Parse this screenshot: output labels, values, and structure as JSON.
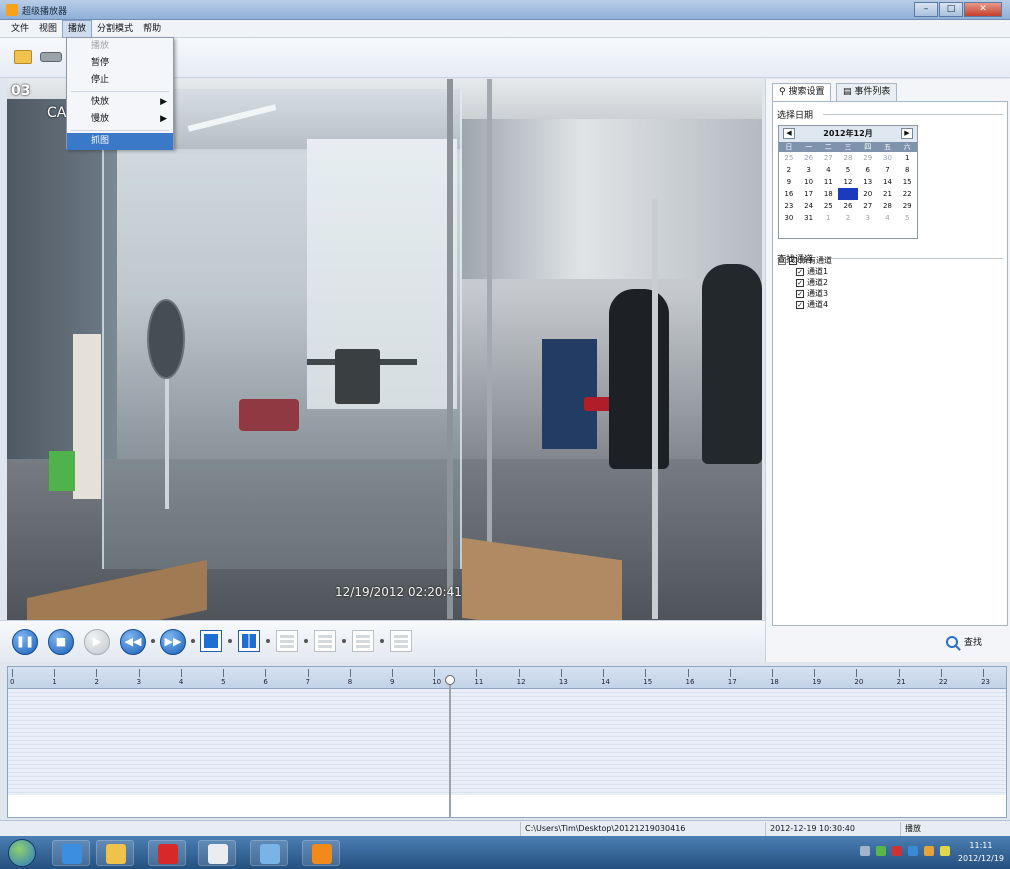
{
  "window": {
    "title": "超级播放器"
  },
  "menubar": {
    "items": [
      "文件",
      "视图",
      "播放",
      "分割模式",
      "帮助"
    ]
  },
  "play_menu": {
    "items": [
      {
        "label": "播放",
        "disabled": true
      },
      {
        "label": "暂停"
      },
      {
        "label": "停止"
      },
      {
        "label": "快放",
        "submenu": true
      },
      {
        "label": "慢放",
        "submenu": true
      },
      {
        "label": "抓图",
        "selected": true
      }
    ]
  },
  "video": {
    "channel": "03",
    "camera": "CA",
    "timestamp": "12/19/2012 02:20:41"
  },
  "sidebar": {
    "tabs": [
      "搜索设置",
      "事件列表"
    ],
    "date_section": "选择日期",
    "calendar": {
      "month": "2012年12月",
      "prev": "◀",
      "next": "▶",
      "weekdays": [
        "日",
        "一",
        "二",
        "三",
        "四",
        "五",
        "六"
      ],
      "weeks": [
        [
          "25",
          "26",
          "27",
          "28",
          "29",
          "30",
          "1"
        ],
        [
          "2",
          "3",
          "4",
          "5",
          "6",
          "7",
          "8"
        ],
        [
          "9",
          "10",
          "11",
          "12",
          "13",
          "14",
          "15"
        ],
        [
          "16",
          "17",
          "18",
          "19",
          "20",
          "21",
          "22"
        ],
        [
          "23",
          "24",
          "25",
          "26",
          "27",
          "28",
          "29"
        ],
        [
          "30",
          "31",
          "1",
          "2",
          "3",
          "4",
          "5"
        ]
      ],
      "selected_day": "19"
    },
    "channel_section": "查找通道",
    "tree": {
      "root": "所有通道",
      "channels": [
        "通道1",
        "通道2",
        "通道3",
        "通道4"
      ]
    },
    "search_label": "查找"
  },
  "timeline": {
    "hours": [
      "0",
      "1",
      "2",
      "3",
      "4",
      "5",
      "6",
      "7",
      "8",
      "9",
      "10",
      "11",
      "12",
      "13",
      "14",
      "15",
      "16",
      "17",
      "18",
      "19",
      "20",
      "21",
      "22",
      "23"
    ],
    "cursor_hour": 10.35
  },
  "status": {
    "path": "C:\\Users\\Tim\\Desktop\\20121219030416",
    "time": "2012-12-19 10:30:40",
    "state": "播放"
  },
  "taskbar": {
    "time": "11:11",
    "date": "2012/12/19"
  }
}
